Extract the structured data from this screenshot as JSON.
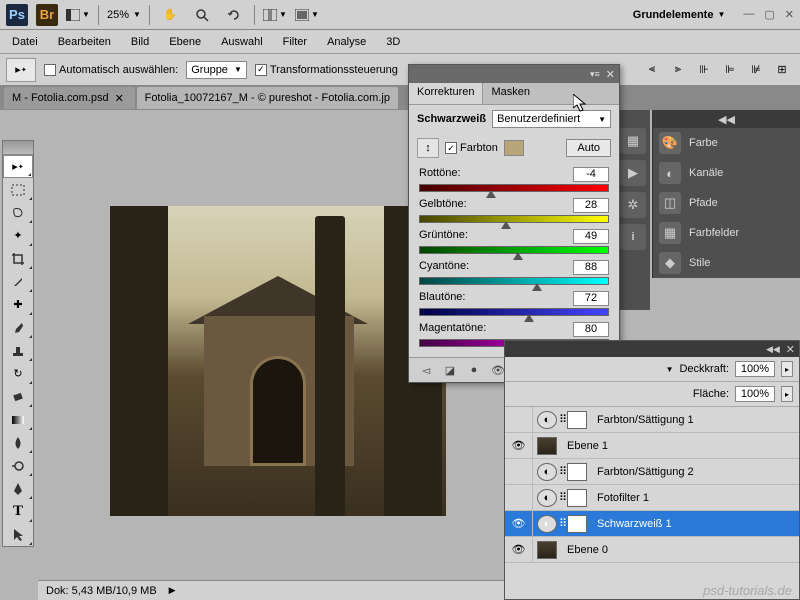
{
  "topbar": {
    "zoom": "25%",
    "workspace": "Grundelemente"
  },
  "menu": {
    "file": "Datei",
    "edit": "Bearbeiten",
    "image": "Bild",
    "layer": "Ebene",
    "select": "Auswahl",
    "filter": "Filter",
    "analysis": "Analyse",
    "threed": "3D"
  },
  "options": {
    "auto_select": "Automatisch auswählen:",
    "group": "Gruppe",
    "transform": "Transformationssteuerung"
  },
  "tabs": {
    "t1": "M - Fotolia.com.psd",
    "t2": "Fotolia_10072167_M - © pureshot - Fotolia.com.jp"
  },
  "rightdock": {
    "color": "Farbe",
    "channels": "Kanäle",
    "paths": "Pfade",
    "swatches": "Farbfelder",
    "styles": "Stile"
  },
  "adj": {
    "tab_corrections": "Korrekturen",
    "tab_masks": "Masken",
    "schwarzweiss": "Schwarzweiß",
    "preset": "Benutzerdefiniert",
    "tint": "Farbton",
    "auto": "Auto",
    "red_l": "Rottöne:",
    "red_v": "-4",
    "yel_l": "Gelbtöne:",
    "yel_v": "28",
    "grn_l": "Grüntöne:",
    "grn_v": "49",
    "cyn_l": "Cyantöne:",
    "cyn_v": "88",
    "blu_l": "Blautöne:",
    "blu_v": "72",
    "mag_l": "Magentatöne:",
    "mag_v": "80"
  },
  "layers": {
    "opacity_l": "Deckkraft:",
    "fill_l": "Fläche:",
    "opacity_v": "100%",
    "fill_v": "100%",
    "l1": "Farbton/Sättigung 1",
    "l2": "Ebene 1",
    "l3": "Farbton/Sättigung 2",
    "l4": "Fotofilter 1",
    "l5": "Schwarzweiß 1",
    "l6": "Ebene 0"
  },
  "status": {
    "docsize": "Dok: 5,43 MB/10,9 MB"
  },
  "watermark": "psd-tutorials.de"
}
